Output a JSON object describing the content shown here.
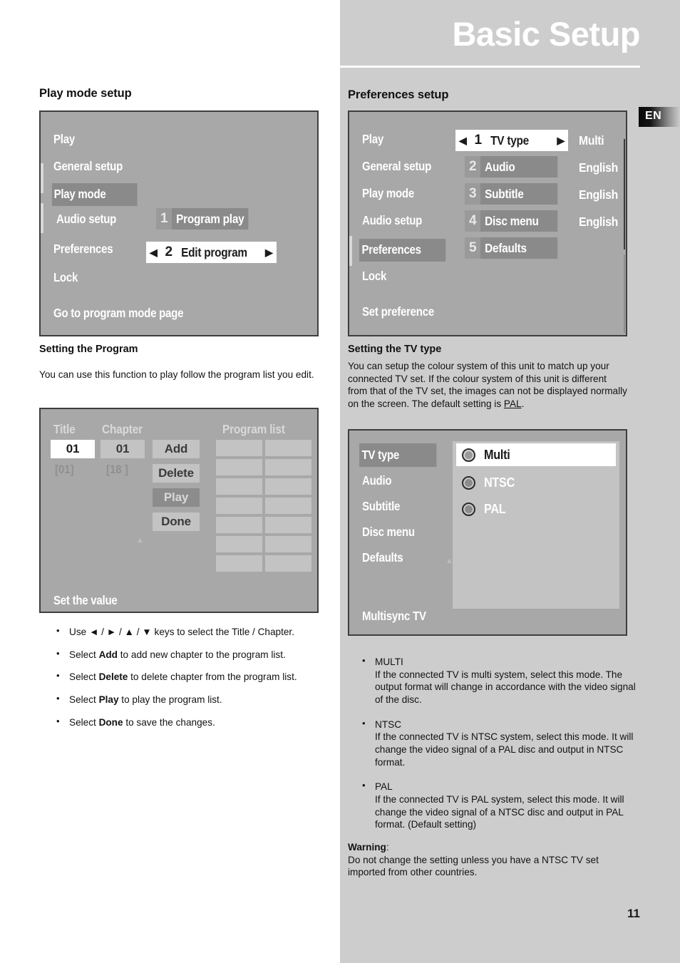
{
  "header": {
    "title": "Basic Setup",
    "lang_badge": "EN"
  },
  "page_number": "11",
  "left": {
    "section_title": "Play mode setup",
    "osd": {
      "menu": [
        "Play",
        "General setup",
        "Play mode",
        "Audio setup",
        "Preferences",
        "Lock"
      ],
      "selected_menu": "Play mode",
      "options": [
        {
          "num": "1",
          "label": "Program play",
          "state": "dark"
        },
        {
          "num": "2",
          "label": "Edit program",
          "state": "light",
          "left_arrow": "◀",
          "right_arrow": "▶"
        }
      ],
      "footer": "Go to program mode page"
    },
    "sub_head": "Setting the Program",
    "paragraph": "You can use this function to play follow the program list you edit.",
    "table_osd": {
      "headers": [
        "Title",
        "Chapter",
        "Program list"
      ],
      "title_value": "01",
      "chapter_value": "01",
      "title_range": "[01]",
      "chapter_range": "[18 ]",
      "buttons": [
        "Add",
        "Delete",
        "Play",
        "Done"
      ],
      "selected_button": "Play",
      "program_rows": 7,
      "program_cols": 2,
      "footer": "Set the value"
    },
    "bullets": [
      {
        "pre": "Use ◄ / ► / ▲ / ▼  keys to select the Title / Chapter."
      },
      {
        "pre": "Select ",
        "bold": "Add",
        "post": " to add new chapter to the program list."
      },
      {
        "pre": "Select ",
        "bold": "Delete",
        "post": " to delete chapter from the program list."
      },
      {
        "pre": "Select ",
        "bold": "Play",
        "post": " to play the program list."
      },
      {
        "pre": "Select ",
        "bold": "Done",
        "post": " to save the changes."
      }
    ]
  },
  "right": {
    "section_title": "Preferences setup",
    "osd": {
      "menu": [
        "Play",
        "General setup",
        "Play mode",
        "Audio setup",
        "Preferences",
        "Lock"
      ],
      "selected_menu": "Preferences",
      "options": [
        {
          "num": "1",
          "label": "TV type",
          "state": "light",
          "left_arrow": "◀",
          "right_arrow": "▶",
          "value": "Multi"
        },
        {
          "num": "2",
          "label": "Audio",
          "state": "dark",
          "value": "English"
        },
        {
          "num": "3",
          "label": "Subtitle",
          "state": "dark",
          "value": "English"
        },
        {
          "num": "4",
          "label": "Disc menu",
          "state": "dark",
          "value": "English"
        },
        {
          "num": "5",
          "label": "Defaults",
          "state": "dark",
          "value": ""
        }
      ],
      "footer": "Set preference"
    },
    "sub_head": "Setting the TV type",
    "paragraph_pre": "You can setup the colour system of this unit to match up your connected TV set. If the colour system of this unit is different from that of the TV set, the images can not be displayed normally on the screen. The default setting is ",
    "paragraph_underlined": "PAL",
    "paragraph_post": ".",
    "tvtype_osd": {
      "menu": [
        "TV type",
        "Audio",
        "Subtitle",
        "Disc menu",
        "Defaults"
      ],
      "selected_menu": "TV type",
      "radio_options": [
        "Multi",
        "NTSC",
        "PAL"
      ],
      "selected_radio": "Multi",
      "footer": "Multisync TV"
    },
    "bullets": [
      {
        "title": "MULTI",
        "body": "If the connected TV is multi system, select this mode. The output format will change in accordance with the video signal of the disc."
      },
      {
        "title": "NTSC",
        "body": "If the connected TV is NTSC system, select this mode. It will change the video signal of a PAL disc and output in NTSC format."
      },
      {
        "title": "PAL",
        "body": "If the connected TV is PAL system, select this mode. It will change the video signal of a NTSC disc and output in PAL format. (Default setting)"
      }
    ],
    "warning_label": "Warning",
    "warning_colon": ":",
    "warning_body": "Do not change the setting unless you have a NTSC TV set imported from other countries."
  },
  "colors": {
    "page_grey": "#cdcdcd",
    "osd_bg": "#a8a8a8",
    "osd_highlight": "#8a8a8a",
    "osd_border": "#3e3e3e",
    "cell_grey": "#c3c3c3"
  }
}
